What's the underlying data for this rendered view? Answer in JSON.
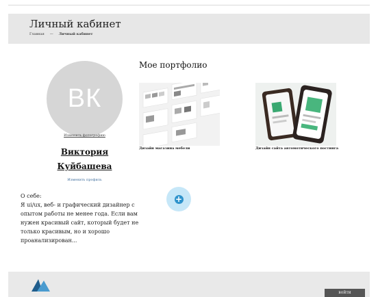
{
  "header": {
    "title": "Личный кабинет",
    "breadcrumb": {
      "home": "Главная",
      "separator": "—",
      "current": "Личный кабинет"
    }
  },
  "profile": {
    "initials": "ВК",
    "change_photo": "Изменить фотографию",
    "first_name": "Виктория",
    "last_name": "Куйбашева",
    "edit_profile": "Изменить профиль",
    "about_label": "О себе:",
    "about_text": "Я ui/ux, веб- и графический дизайнер с опытом работы не менее года. Если вам нужен красивый сайт, который будет не только красивым, но и хорошо проанализирован..."
  },
  "portfolio": {
    "title": "Мое портфолио",
    "items": [
      {
        "caption": "Дизайн магазина мебели"
      },
      {
        "caption": "Дизайн сайта автомотического постинга"
      }
    ]
  },
  "add_button": {
    "icon": "plus-icon",
    "symbol": "+"
  },
  "footer": {
    "login_label": "войти"
  },
  "colors": {
    "accent": "#2e93cc",
    "accent_light": "#c6e7f8",
    "header_bg": "#e7e7e7",
    "button_bg": "#555555"
  }
}
